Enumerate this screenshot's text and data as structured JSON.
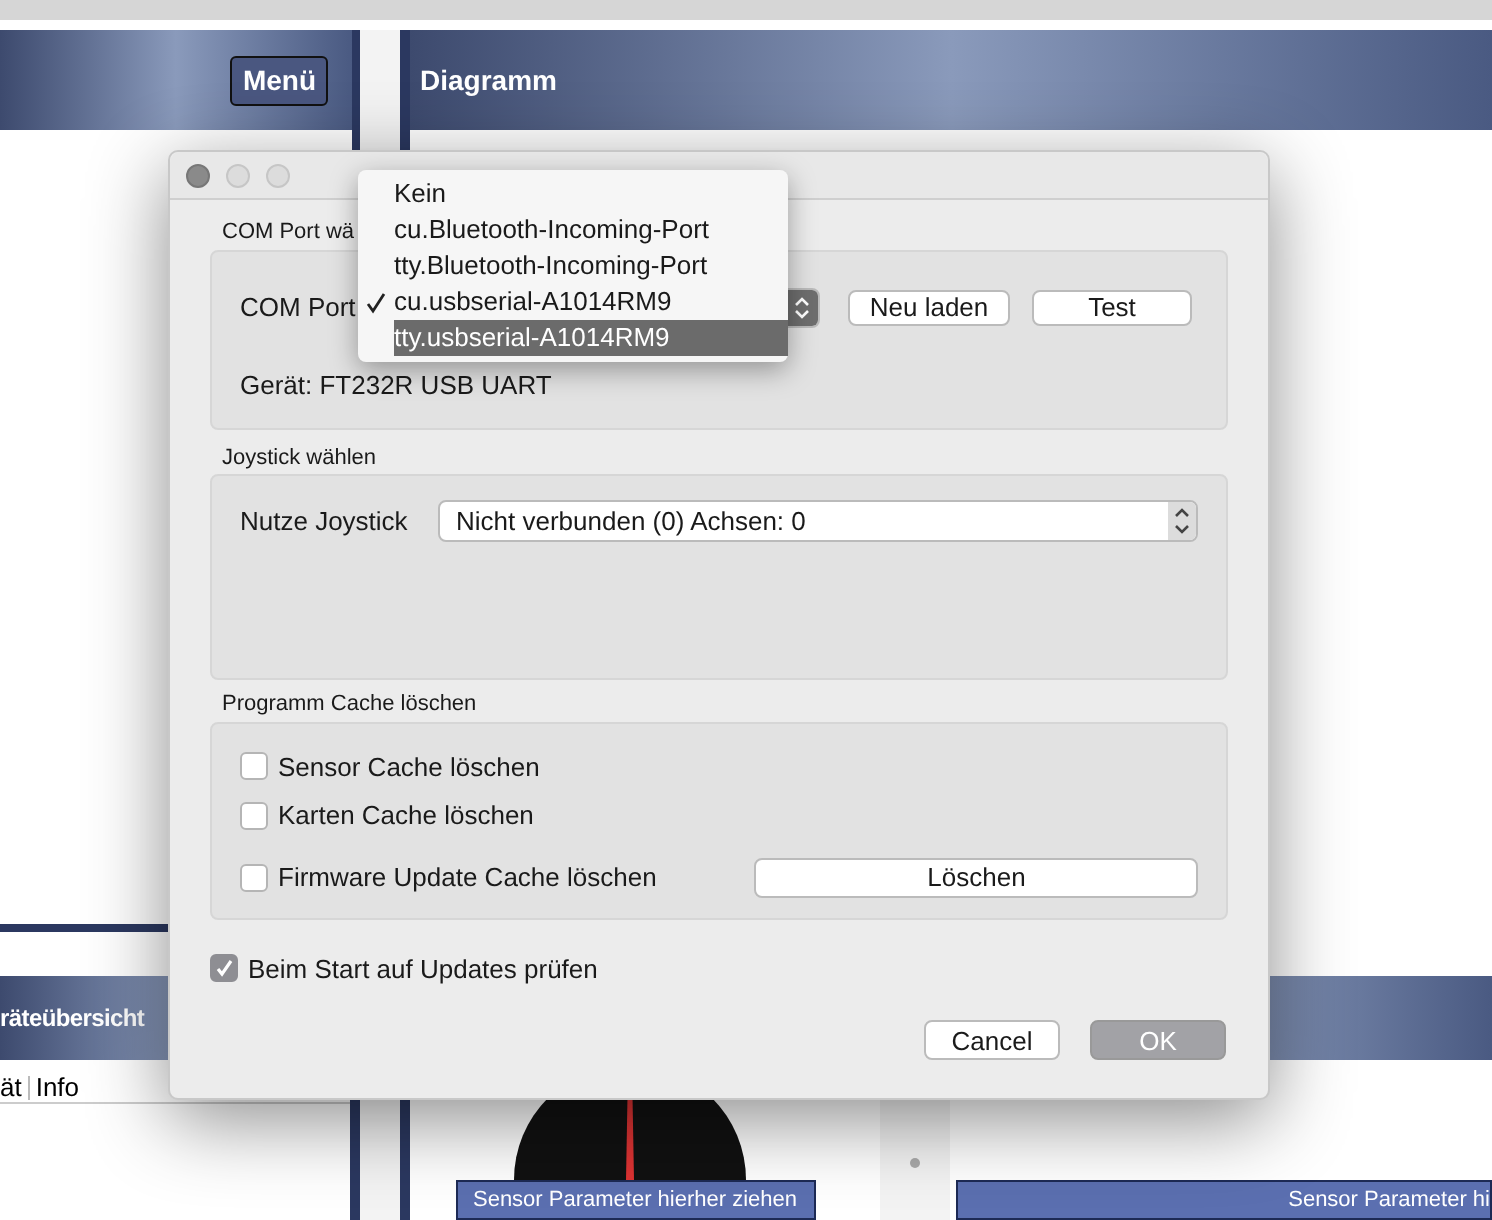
{
  "app": {
    "menu_button": "Menü",
    "diagram_title": "Diagramm",
    "overview_title": "räteübersicht",
    "overview_tabs": [
      {
        "label": "ät",
        "selected": false
      },
      {
        "label": "Info",
        "selected": false
      }
    ],
    "drop_zones": [
      "Sensor Parameter hierher ziehen",
      "Sensor Parameter hi"
    ]
  },
  "dialog": {
    "com_group": {
      "title": "COM Port wä",
      "label": "COM Port",
      "reload_button": "Neu laden",
      "test_button": "Test",
      "device": "Gerät: FT232R USB UART"
    },
    "joystick_group": {
      "title": "Joystick wählen",
      "label": "Nutze Joystick",
      "value": "Nicht verbunden (0) Achsen: 0"
    },
    "cache_group": {
      "title": "Programm Cache löschen",
      "options": [
        {
          "label": "Sensor Cache löschen",
          "checked": false
        },
        {
          "label": "Karten Cache löschen",
          "checked": false
        },
        {
          "label": "Firmware Update Cache löschen",
          "checked": false
        }
      ],
      "delete_button": "Löschen"
    },
    "update_check": {
      "label": "Beim Start auf Updates prüfen",
      "checked": true
    },
    "buttons": [
      {
        "label": "Cancel",
        "kind": "normal"
      },
      {
        "label": "OK",
        "kind": "default"
      }
    ]
  },
  "port_menu": {
    "items": [
      {
        "label": "Kein",
        "selected": false,
        "highlighted": false
      },
      {
        "label": "cu.Bluetooth-Incoming-Port",
        "selected": false,
        "highlighted": false
      },
      {
        "label": "tty.Bluetooth-Incoming-Port",
        "selected": false,
        "highlighted": false
      },
      {
        "label": "cu.usbserial-A1014RM9",
        "selected": true,
        "highlighted": false
      },
      {
        "label": "tty.usbserial-A1014RM9",
        "selected": false,
        "highlighted": true
      }
    ]
  }
}
